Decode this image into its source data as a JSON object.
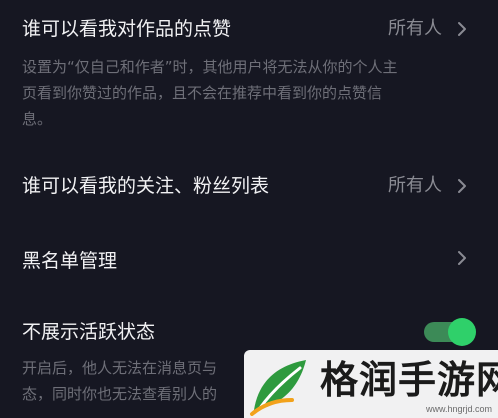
{
  "settings": {
    "like_visibility": {
      "title": "谁可以看我对作品的点赞",
      "value": "所有人",
      "description_line1": "设置为“仅自己和作者”时，其他用户将无法从你的个人主",
      "description_line2": "页看到你赞过的作品，且不会在推荐中看到你的点赞信",
      "description_line3": "息。"
    },
    "follow_list_visibility": {
      "title": "谁可以看我的关注、粉丝列表",
      "value": "所有人"
    },
    "blacklist": {
      "title": "黑名单管理"
    },
    "hide_activity": {
      "title": "不展示活跃状态",
      "enabled": true,
      "description_line1": "开启后，他人无法在消息页与",
      "description_line2": "态，同时你也无法查看别人的"
    }
  },
  "watermark": {
    "text": "格润手游网",
    "url": "www.hngrjd.com"
  },
  "colors": {
    "background": "#161722",
    "title": "#f1f1f3",
    "value": "#8a8b93",
    "description": "#6e6f78",
    "toggle_on": "#2fd06a"
  }
}
